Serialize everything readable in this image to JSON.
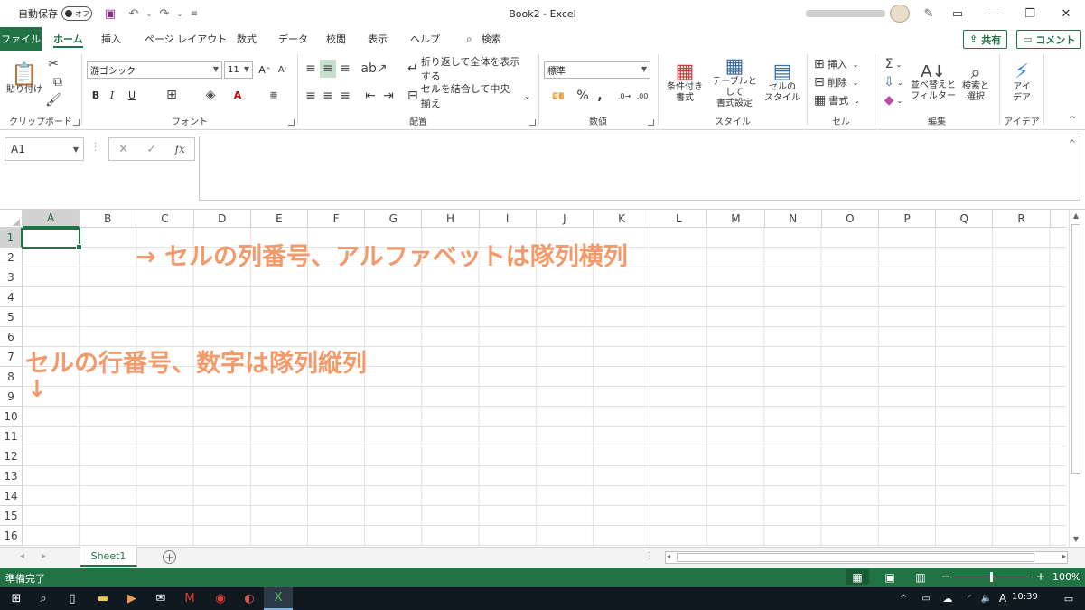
{
  "titlebar": {
    "autosave_label": "自動保存",
    "autosave_state": "オフ",
    "title": "Book2  -  Excel",
    "icons": [
      "save-icon",
      "undo-icon",
      "redo-icon",
      "customize-icon",
      "pen-icon",
      "ribbon-display-icon",
      "minimize-icon",
      "restore-icon",
      "close-icon"
    ]
  },
  "tabs": [
    "ファイル",
    "ホーム",
    "挿入",
    "ページ レイアウト",
    "数式",
    "データ",
    "校閲",
    "表示",
    "ヘルプ"
  ],
  "search": {
    "label": "検索"
  },
  "share": {
    "share_label": "共有",
    "comment_label": "コメント"
  },
  "ribbon": {
    "clipboard": {
      "paste": "貼り付け",
      "label": "クリップボード"
    },
    "font": {
      "name": "游ゴシック",
      "size": "11",
      "label": "フォント",
      "bold": "B",
      "italic": "I",
      "underline": "U"
    },
    "alignment": {
      "wrap": "折り返して全体を表示する",
      "merge": "セルを結合して中央揃え",
      "label": "配置"
    },
    "number": {
      "format": "標準",
      "label": "数値"
    },
    "styles": {
      "conditional": "条件付き\n書式",
      "table": "テーブルとして\n書式設定",
      "cellstyle": "セルの\nスタイル",
      "label": "スタイル"
    },
    "cells": {
      "insert": "挿入",
      "delete": "削除",
      "format": "書式",
      "label": "セル"
    },
    "editing": {
      "sort": "並べ替えと\nフィルター",
      "find": "検索と\n選択",
      "label": "編集"
    },
    "ideas": {
      "name": "アイ\nデア",
      "label": "アイデア"
    }
  },
  "formula_bar": {
    "name_box": "A1",
    "fx": "fx",
    "formula": ""
  },
  "grid": {
    "columns": [
      "A",
      "B",
      "C",
      "D",
      "E",
      "F",
      "G",
      "H",
      "I",
      "J",
      "K",
      "L",
      "M",
      "N",
      "O",
      "P",
      "Q",
      "R"
    ],
    "rows": [
      "1",
      "2",
      "3",
      "4",
      "5",
      "6",
      "7",
      "8",
      "9",
      "10",
      "11",
      "12",
      "13",
      "14",
      "15",
      "16"
    ],
    "active_cell": "A1"
  },
  "annotations": {
    "columns_note": "→ セルの列番号、アルファベットは隊列横列",
    "rows_note": "セルの行番号、数字は隊列縦列",
    "rows_arrow": "↓"
  },
  "sheets": {
    "tabs": [
      "Sheet1"
    ]
  },
  "status": {
    "ready": "準備完了",
    "zoom": "100%"
  },
  "taskbar": {
    "time": "10:39"
  },
  "colors": {
    "excel_green": "#217346",
    "annotation": "#f39a6b"
  }
}
